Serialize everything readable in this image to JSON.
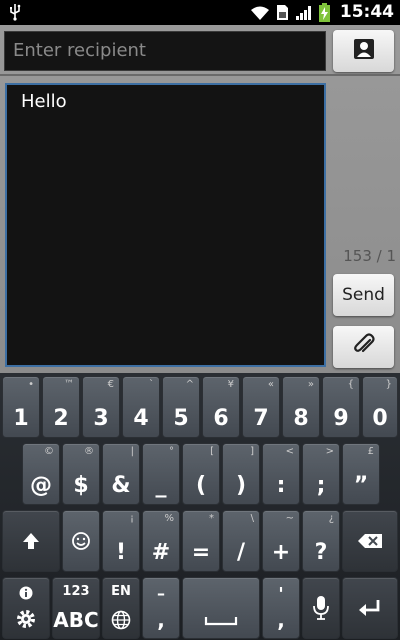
{
  "status_bar": {
    "time": "15:44",
    "icons": [
      "usb-icon",
      "wifi-icon",
      "sim-icon",
      "signal-icon",
      "battery-charging-icon"
    ]
  },
  "compose": {
    "recipient_placeholder": "Enter recipient",
    "message_text": "Hello",
    "char_counter": "153 / 1",
    "send_label": "Send"
  },
  "keyboard": {
    "row1": [
      {
        "main": "1",
        "hint": "•"
      },
      {
        "main": "2",
        "hint": "™"
      },
      {
        "main": "3",
        "hint": "€"
      },
      {
        "main": "4",
        "hint": "`"
      },
      {
        "main": "5",
        "hint": "^"
      },
      {
        "main": "6",
        "hint": "¥"
      },
      {
        "main": "7",
        "hint": "«"
      },
      {
        "main": "8",
        "hint": "»"
      },
      {
        "main": "9",
        "hint": "{"
      },
      {
        "main": "0",
        "hint": "}"
      }
    ],
    "row2": [
      {
        "main": "@",
        "hint": "©"
      },
      {
        "main": "$",
        "hint": "®"
      },
      {
        "main": "&",
        "hint": "|"
      },
      {
        "main": "_",
        "hint": "°"
      },
      {
        "main": "(",
        "hint": "["
      },
      {
        "main": ")",
        "hint": "]"
      },
      {
        "main": ":",
        "hint": "<"
      },
      {
        "main": ";",
        "hint": ">"
      },
      {
        "main": "”",
        "hint": "£"
      }
    ],
    "row3": [
      {
        "main": "!",
        "hint": "¡"
      },
      {
        "main": "#",
        "hint": "%"
      },
      {
        "main": "=",
        "hint": "*"
      },
      {
        "main": "/",
        "hint": "\\"
      },
      {
        "main": "+",
        "hint": "~"
      },
      {
        "main": "?",
        "hint": "¿"
      }
    ],
    "row4": {
      "abc_top": "123",
      "abc_bottom": "ABC",
      "lang_label": "EN",
      "dash_top": "–",
      "dash_bottom": ",",
      "punct_top": "'",
      "punct_bottom": ","
    }
  }
}
